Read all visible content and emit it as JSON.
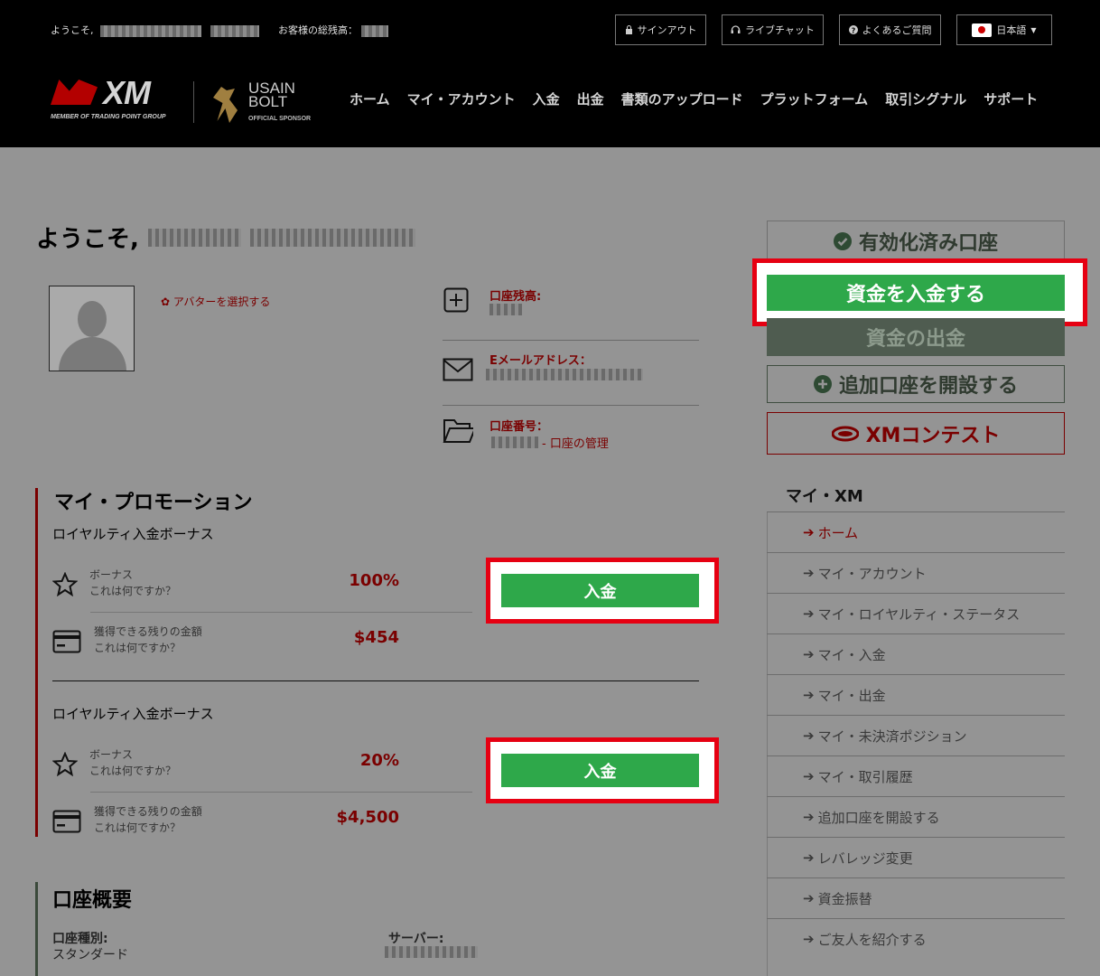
{
  "topbar": {
    "welcome": "ようこそ,",
    "balance_label": "お客様の総残高：",
    "signout": "サインアウト",
    "livechat": "ライブチャット",
    "faq": "よくあるご質問",
    "language": "日本語"
  },
  "logo": {
    "brand": "XM",
    "tagline": "MEMBER OF TRADING POINT GROUP",
    "sponsor_line1": "USAIN",
    "sponsor_line2": "BOLT",
    "sponsor_sub": "OFFICIAL SPONSOR"
  },
  "nav": [
    "ホーム",
    "マイ・アカウント",
    "入金",
    "出金",
    "書類のアップロード",
    "プラットフォーム",
    "取引シグナル",
    "サポート"
  ],
  "profile": {
    "greeting": "ようこそ,",
    "choose_avatar": "アバターを選択する",
    "balance_label": "口座残高:",
    "email_label": "Eメールアドレス：",
    "account_label": "口座番号：",
    "account_manage": "- 口座の管理"
  },
  "promotions": {
    "title": "マイ・プロモーション",
    "items": [
      {
        "title": "ロイヤルティ入金ボーナス",
        "bonus_label": "ボーナス",
        "help": "これは何ですか？",
        "bonus_value": "100%",
        "remain_label": "獲得できる残りの金額",
        "remain_value": "$454",
        "deposit": "入金"
      },
      {
        "title": "ロイヤルティ入金ボーナス",
        "bonus_label": "ボーナス",
        "help": "これは何ですか？",
        "bonus_value": "20%",
        "remain_label": "獲得できる残りの金額",
        "remain_value": "$4,500",
        "deposit": "入金"
      }
    ]
  },
  "overview": {
    "title": "口座概要",
    "type_label": "口座種別:",
    "type_value": "スタンダード",
    "server_label": "サーバー:"
  },
  "side": {
    "verified": "有効化済み口座",
    "deposit": "資金を入金する",
    "withdraw": "資金の出金",
    "add_account": "追加口座を開設する",
    "contest": "XMコンテスト",
    "menu_title": "マイ・XM",
    "menu": [
      "ホーム",
      "マイ・アカウント",
      "マイ・ロイヤルティ・ステータス",
      "マイ・入金",
      "マイ・出金",
      "マイ・未決済ポジション",
      "マイ・取引履歴",
      "追加口座を開設する",
      "レバレッジ変更",
      "資金振替",
      "ご友人を紹介する"
    ]
  },
  "colors": {
    "accent_red": "#7a0000",
    "highlight_red": "#e60012",
    "green": "#2ea84a",
    "overlay": "#949494"
  }
}
